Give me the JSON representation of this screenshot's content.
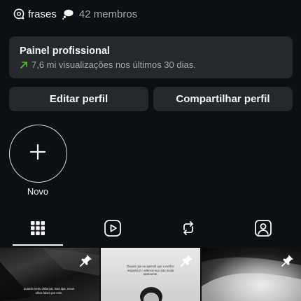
{
  "header": {
    "community_name": "frases",
    "members": "42 membros"
  },
  "professional_panel": {
    "title": "Painel profissional",
    "subtitle": "7,6 mi visualizações nos últimos 30 dias."
  },
  "actions": {
    "edit_label": "Editar perfil",
    "share_label": "Compartilhar perfil"
  },
  "highlights": {
    "new_label": "Novo"
  },
  "tabs": [
    {
      "name": "grid",
      "icon": "grid-icon",
      "active": true
    },
    {
      "name": "reels",
      "icon": "reels-icon",
      "active": false
    },
    {
      "name": "reposts",
      "icon": "repost-icon",
      "active": false
    },
    {
      "name": "tagged",
      "icon": "tagged-icon",
      "active": false
    }
  ],
  "posts": [
    {
      "text": "quando tento disfarçar, mas spa, meus olhos falam por mim.",
      "pinned": true
    },
    {
      "text": "Depois que eu aprendi que o melhor resposta é o silêncio sua vida muda totalmente.",
      "pinned": true
    },
    {
      "text": "",
      "pinned": true
    }
  ],
  "colors": {
    "background": "#0c1014",
    "card": "#25292e",
    "trend_arrow": "#58c322",
    "muted_text": "#a8a8a8"
  }
}
